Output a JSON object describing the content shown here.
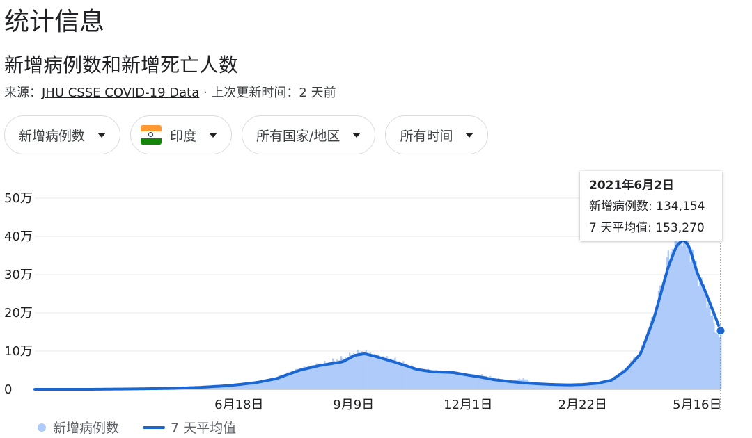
{
  "page": {
    "title": "统计信息"
  },
  "header": {
    "chart_title": "新增病例数和新增死亡人数",
    "source_prefix": "来源：",
    "source_link": "JHU CSSE COVID-19 Data",
    "update_text": " · 上次更新时间：2 天前"
  },
  "filters": [
    {
      "label": "新增病例数"
    },
    {
      "label": "印度",
      "flag": [
        "#ff9933",
        "#ffffff",
        "#138808"
      ]
    },
    {
      "label": "所有国家/地区"
    },
    {
      "label": "所有时间"
    }
  ],
  "tooltip": {
    "date": "2021年6月2日",
    "cases_text": "新增病例数: 134,154",
    "avg_text": "7 天平均值: 153,270"
  },
  "legend": {
    "cases_label": "新增病例数",
    "avg_label": "7 天平均值"
  },
  "colors": {
    "bar": "#aecbfa",
    "line": "#1a66d2",
    "grid": "#e8eaed",
    "axis": "#9aa0a6",
    "text": "#202124"
  },
  "chart_data": {
    "type": "bar",
    "title": "新增病例数和新增死亡人数",
    "xlabel": "",
    "ylabel": "",
    "ylim": [
      0,
      500000
    ],
    "y_ticks": [
      {
        "value": 0,
        "label": "0"
      },
      {
        "value": 100000,
        "label": "10万"
      },
      {
        "value": 200000,
        "label": "20万"
      },
      {
        "value": 300000,
        "label": "30万"
      },
      {
        "value": 400000,
        "label": "40万"
      },
      {
        "value": 500000,
        "label": "50万"
      }
    ],
    "x_range": [
      "2020-01-22",
      "2021-06-02"
    ],
    "x_ticks": [
      {
        "date": "2020-06-18",
        "label": "6月18日"
      },
      {
        "date": "2020-09-09",
        "label": "9月9日"
      },
      {
        "date": "2020-12-01",
        "label": "12月1日"
      },
      {
        "date": "2021-02-22",
        "label": "2月22日"
      },
      {
        "date": "2021-05-16",
        "label": "5月16日"
      }
    ],
    "series": [
      {
        "name": "新增病例数",
        "type": "bar",
        "points": [
          [
            "2020-01-22",
            0
          ],
          [
            "2020-03-01",
            0
          ],
          [
            "2020-04-01",
            1500
          ],
          [
            "2020-05-01",
            2500
          ],
          [
            "2020-05-20",
            5500
          ],
          [
            "2020-06-10",
            10000
          ],
          [
            "2020-06-18",
            13500
          ],
          [
            "2020-07-01",
            19000
          ],
          [
            "2020-07-15",
            30000
          ],
          [
            "2020-08-01",
            54000
          ],
          [
            "2020-08-15",
            65000
          ],
          [
            "2020-09-01",
            80000
          ],
          [
            "2020-09-10",
            94000
          ],
          [
            "2020-09-17",
            96500
          ],
          [
            "2020-09-25",
            87000
          ],
          [
            "2020-10-10",
            75000
          ],
          [
            "2020-10-25",
            52000
          ],
          [
            "2020-11-05",
            48000
          ],
          [
            "2020-11-20",
            45000
          ],
          [
            "2020-12-01",
            35000
          ],
          [
            "2020-12-10",
            37000
          ],
          [
            "2020-12-20",
            30000
          ],
          [
            "2021-01-01",
            22000
          ],
          [
            "2021-01-10",
            28000
          ],
          [
            "2021-01-20",
            14000
          ],
          [
            "2021-02-01",
            13000
          ],
          [
            "2021-02-12",
            11500
          ],
          [
            "2021-02-22",
            12000
          ],
          [
            "2021-03-05",
            17000
          ],
          [
            "2021-03-15",
            26000
          ],
          [
            "2021-03-25",
            54000
          ],
          [
            "2021-04-05",
            100000
          ],
          [
            "2021-04-15",
            200000
          ],
          [
            "2021-04-25",
            340000
          ],
          [
            "2021-05-01",
            400000
          ],
          [
            "2021-05-06",
            412000
          ],
          [
            "2021-05-10",
            380000
          ],
          [
            "2021-05-16",
            310000
          ],
          [
            "2021-05-22",
            250000
          ],
          [
            "2021-05-28",
            170000
          ],
          [
            "2021-06-02",
            134154
          ]
        ]
      },
      {
        "name": "7 天平均值",
        "type": "line",
        "points": [
          [
            "2020-01-22",
            0
          ],
          [
            "2020-03-01",
            0
          ],
          [
            "2020-04-01",
            1000
          ],
          [
            "2020-05-01",
            2500
          ],
          [
            "2020-05-20",
            5000
          ],
          [
            "2020-06-10",
            9500
          ],
          [
            "2020-06-18",
            12500
          ],
          [
            "2020-07-01",
            18000
          ],
          [
            "2020-07-15",
            28000
          ],
          [
            "2020-08-01",
            50000
          ],
          [
            "2020-08-15",
            62000
          ],
          [
            "2020-09-01",
            72000
          ],
          [
            "2020-09-10",
            89000
          ],
          [
            "2020-09-17",
            93000
          ],
          [
            "2020-09-25",
            86000
          ],
          [
            "2020-10-10",
            70000
          ],
          [
            "2020-10-25",
            52000
          ],
          [
            "2020-11-05",
            46000
          ],
          [
            "2020-11-20",
            44000
          ],
          [
            "2020-12-01",
            37000
          ],
          [
            "2020-12-10",
            32000
          ],
          [
            "2020-12-20",
            25000
          ],
          [
            "2021-01-01",
            20000
          ],
          [
            "2021-01-10",
            17000
          ],
          [
            "2021-01-20",
            14500
          ],
          [
            "2021-02-01",
            12500
          ],
          [
            "2021-02-12",
            11500
          ],
          [
            "2021-02-22",
            12500
          ],
          [
            "2021-03-05",
            16000
          ],
          [
            "2021-03-15",
            24000
          ],
          [
            "2021-03-25",
            49000
          ],
          [
            "2021-04-05",
            93000
          ],
          [
            "2021-04-15",
            190000
          ],
          [
            "2021-04-25",
            320000
          ],
          [
            "2021-05-01",
            375000
          ],
          [
            "2021-05-06",
            392000
          ],
          [
            "2021-05-10",
            375000
          ],
          [
            "2021-05-16",
            305000
          ],
          [
            "2021-05-22",
            255000
          ],
          [
            "2021-05-28",
            200000
          ],
          [
            "2021-06-02",
            153270
          ]
        ]
      }
    ],
    "highlight": {
      "date": "2021-06-02",
      "value": 153270
    },
    "grid": true,
    "legend_position": "bottom-left"
  }
}
